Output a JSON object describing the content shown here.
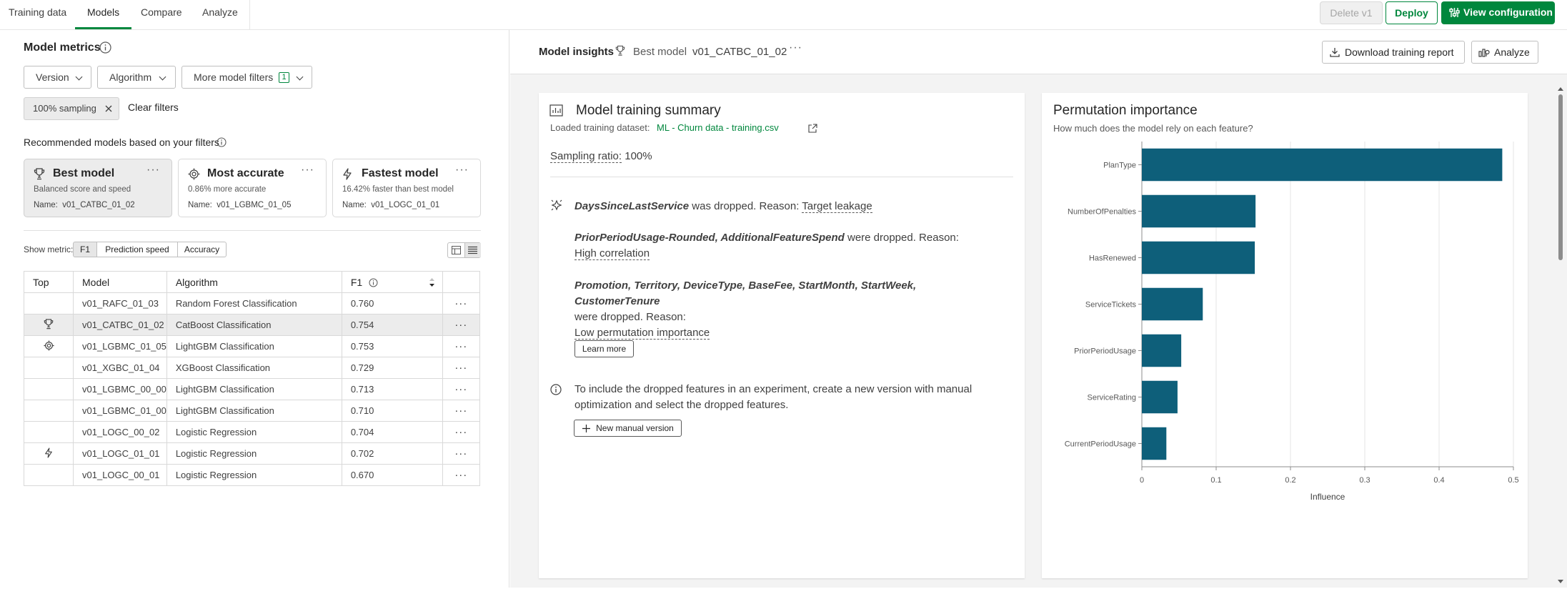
{
  "tabs": [
    {
      "label": "Training data"
    },
    {
      "label": "Models"
    },
    {
      "label": "Compare"
    },
    {
      "label": "Analyze"
    }
  ],
  "header_buttons": {
    "delete": "Delete v1",
    "deploy": "Deploy",
    "view_config": "View configuration"
  },
  "left": {
    "title": "Model metrics",
    "filters": {
      "version": "Version",
      "algorithm": "Algorithm",
      "more": "More model filters",
      "more_count": "1"
    },
    "chip": "100% sampling",
    "clear": "Clear filters",
    "recommended_title": "Recommended models based on your filters",
    "cards": [
      {
        "title": "Best model",
        "subtitle": "Balanced score and speed",
        "name_label": "Name:",
        "name": "v01_CATBC_01_02",
        "icon": "trophy-icon"
      },
      {
        "title": "Most accurate",
        "subtitle": "0.86% more accurate",
        "name_label": "Name:",
        "name": "v01_LGBMC_01_05",
        "icon": "target-icon"
      },
      {
        "title": "Fastest model",
        "subtitle": "16.42% faster than best model",
        "name_label": "Name:",
        "name": "v01_LOGC_01_01",
        "icon": "lightning-icon"
      }
    ],
    "show_metric_label": "Show metric:",
    "metric_options": [
      "F1",
      "Prediction speed",
      "Accuracy"
    ],
    "selected_metric": "F1",
    "table": {
      "headers": [
        "Top",
        "Model",
        "Algorithm",
        "F1"
      ],
      "rows": [
        {
          "top": "",
          "model": "v01_RAFC_01_03",
          "algorithm": "Random Forest Classification",
          "f1": "0.760"
        },
        {
          "top": "trophy-icon",
          "model": "v01_CATBC_01_02",
          "algorithm": "CatBoost Classification",
          "f1": "0.754"
        },
        {
          "top": "target-icon",
          "model": "v01_LGBMC_01_05",
          "algorithm": "LightGBM Classification",
          "f1": "0.753"
        },
        {
          "top": "",
          "model": "v01_XGBC_01_04",
          "algorithm": "XGBoost Classification",
          "f1": "0.729"
        },
        {
          "top": "",
          "model": "v01_LGBMC_00_00",
          "algorithm": "LightGBM Classification",
          "f1": "0.713"
        },
        {
          "top": "",
          "model": "v01_LGBMC_01_00",
          "algorithm": "LightGBM Classification",
          "f1": "0.710"
        },
        {
          "top": "",
          "model": "v01_LOGC_00_02",
          "algorithm": "Logistic Regression",
          "f1": "0.704"
        },
        {
          "top": "lightning-icon",
          "model": "v01_LOGC_01_01",
          "algorithm": "Logistic Regression",
          "f1": "0.702"
        },
        {
          "top": "",
          "model": "v01_LOGC_00_01",
          "algorithm": "Logistic Regression",
          "f1": "0.670"
        }
      ]
    }
  },
  "insights": {
    "title": "Model insights",
    "best_label": "Best model",
    "model": "v01_CATBC_01_02",
    "download": "Download training report",
    "analyze": "Analyze"
  },
  "summary": {
    "title": "Model training summary",
    "dataset_label": "Loaded training dataset:",
    "dataset": "ML - Churn data - training.csv",
    "sampling_label": "Sampling ratio:",
    "sampling_value": "100%",
    "drop1_feature": "DaysSinceLastService",
    "drop1_text": "was dropped. Reason:",
    "drop1_reason": "Target leakage",
    "drop2_features": "PriorPeriodUsage-Rounded, AdditionalFeatureSpend",
    "drop2_text": "were dropped. Reason:",
    "drop2_reason": "High correlation",
    "drop3_features": "Promotion, Territory, DeviceType, BaseFee, StartMonth, StartWeek, CustomerTenure",
    "drop3_text": "were dropped. Reason:",
    "drop3_reason": "Low permutation importance",
    "learn_more": "Learn more",
    "info_line1": "To include the dropped features in an experiment, create a new version with manual",
    "info_line2": "optimization and select the dropped features.",
    "new_manual": "New manual version"
  },
  "chart_data": {
    "type": "bar",
    "orientation": "horizontal",
    "title": "Permutation importance",
    "subtitle": "How much does the model rely on each feature?",
    "categories": [
      "PlanType",
      "NumberOfPenalties",
      "HasRenewed",
      "ServiceTickets",
      "PriorPeriodUsage",
      "ServiceRating",
      "CurrentPeriodUsage"
    ],
    "values": [
      0.485,
      0.153,
      0.152,
      0.082,
      0.053,
      0.048,
      0.033
    ],
    "xlabel": "Influence",
    "xlim": [
      0,
      0.5
    ],
    "xticks": [
      "0",
      "0.1",
      "0.2",
      "0.3",
      "0.4",
      "0.5"
    ],
    "color": "#0e5f7a",
    "grid": true
  },
  "colors": {
    "accent": "#00873d",
    "bar": "#0e5f7a",
    "link": "#00873d"
  }
}
